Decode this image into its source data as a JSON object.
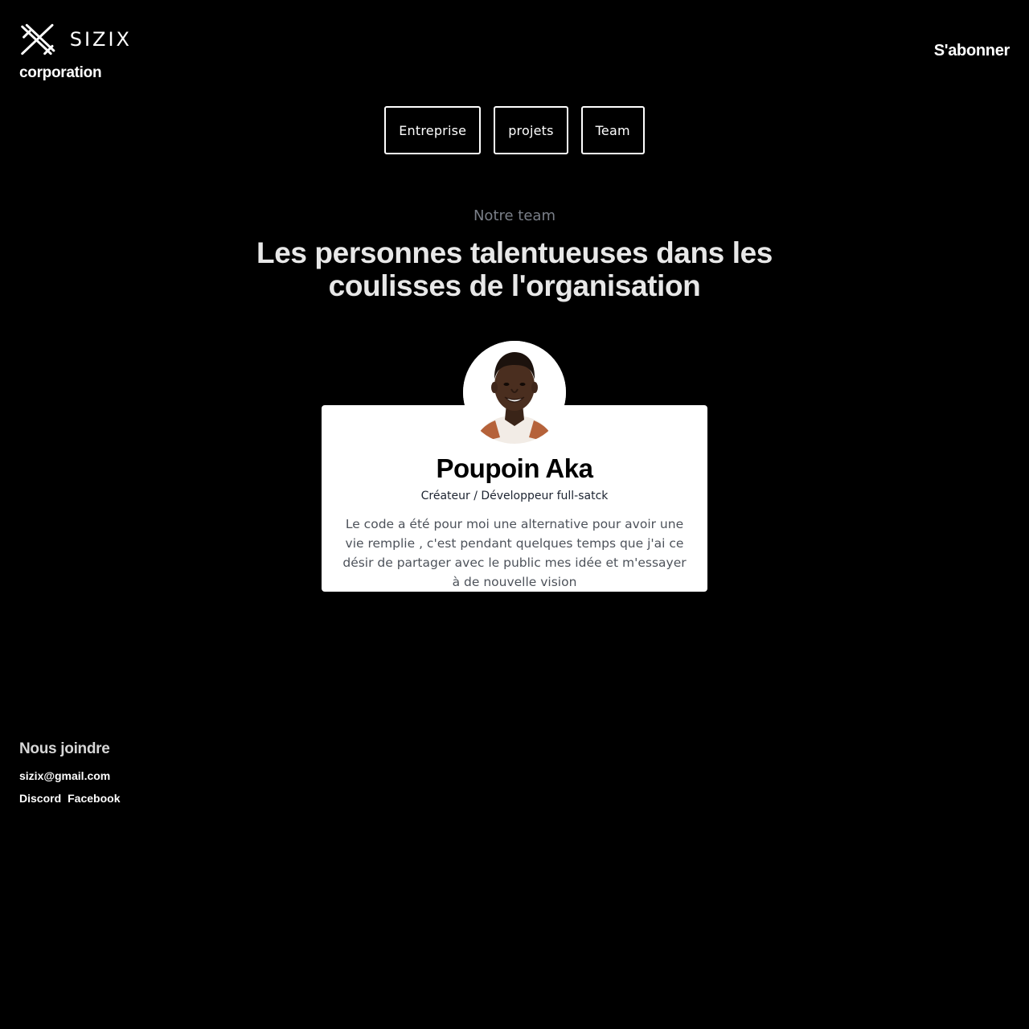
{
  "header": {
    "brand_name": "SIZIX",
    "tagline": "corporation",
    "subscribe_label": "S'abonner"
  },
  "nav": {
    "items": [
      {
        "label": "Entreprise"
      },
      {
        "label": "projets"
      },
      {
        "label": "Team"
      }
    ]
  },
  "team_section": {
    "eyebrow": "Notre team",
    "headline": "Les personnes talentueuses dans les coulisses de l'organisation",
    "member": {
      "name": "Poupoin Aka",
      "role": "Créateur / Développeur full-satck",
      "bio": "Le code a été pour moi une alternative pour avoir une vie remplie , c'est pendant quelques temps que j'ai ce désir de partager avec le public mes idée et m'essayer à de nouvelle vision",
      "avatar_icon": "person-portrait"
    }
  },
  "footer": {
    "join_title": "Nous joindre",
    "email": "sizix@gmail.com",
    "socials": [
      {
        "label": "Discord"
      },
      {
        "label": "Facebook"
      }
    ]
  },
  "colors": {
    "background": "#000000",
    "text": "#ffffff",
    "muted": "#7a7f88",
    "card": "#ffffff"
  }
}
